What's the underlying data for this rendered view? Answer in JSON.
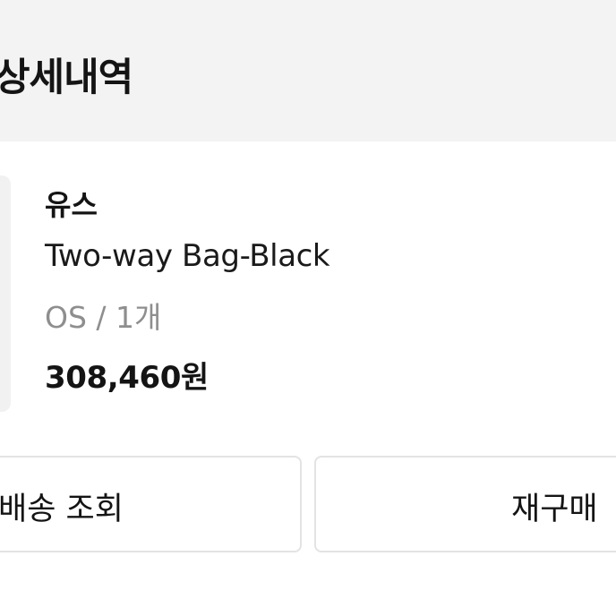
{
  "header": {
    "title": "상세내역"
  },
  "order_item": {
    "brand": "유스",
    "product_name": "Two-way Bag-Black",
    "option": "OS / 1개",
    "price": "308,460원"
  },
  "actions": {
    "track_delivery_label": "배송 조회",
    "reorder_label": "재구매"
  },
  "colors": {
    "header_background": "#f3f3f3",
    "text_primary": "#141414",
    "text_secondary": "#8e8e8e",
    "button_border": "#e3e3e3"
  }
}
